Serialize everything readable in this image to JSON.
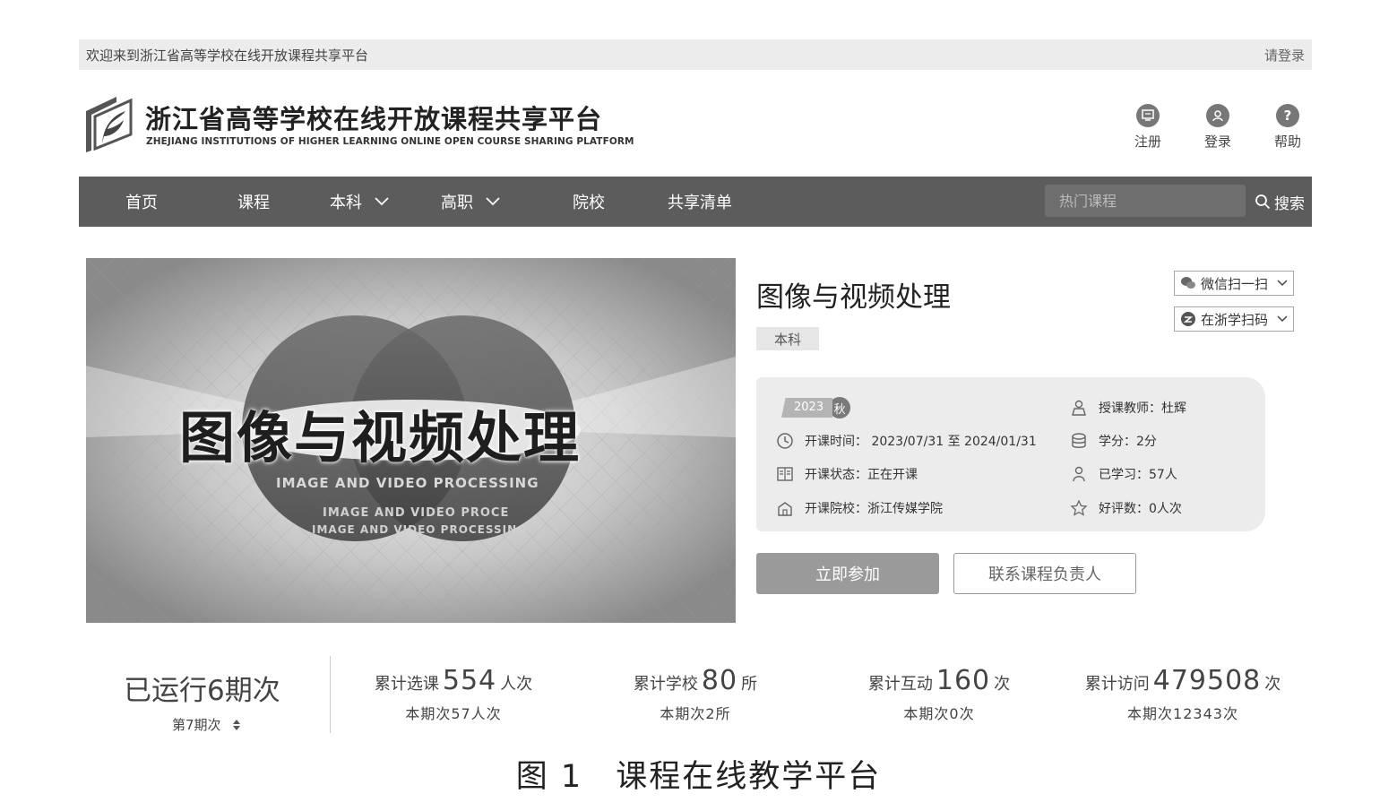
{
  "topbar": {
    "welcome": "欢迎来到浙江省高等学校在线开放课程共享平台",
    "login_link": "请登录"
  },
  "header": {
    "title": "浙江省高等学校在线开放课程共享平台",
    "subtitle": "ZHEJIANG INSTITUTIONS OF HIGHER LEARNING ONLINE OPEN COURSE SHARING PLATFORM",
    "actions": [
      {
        "label": "注册",
        "icon": "register-icon"
      },
      {
        "label": "登录",
        "icon": "user-icon"
      },
      {
        "label": "帮助",
        "icon": "help-icon"
      }
    ]
  },
  "nav": {
    "items": [
      {
        "label": "首页"
      },
      {
        "label": "课程"
      },
      {
        "label": "本科",
        "dropdown": true
      },
      {
        "label": "高职",
        "dropdown": true
      },
      {
        "label": "院校"
      },
      {
        "label": "共享清单"
      }
    ],
    "search_placeholder": "热门课程",
    "search_label": "搜索"
  },
  "banner": {
    "title": "图像与视频处理",
    "subtitle_lines": [
      "IMAGE AND VIDEO PROCESSING",
      "IMAGE AND VIDEO PROCE",
      "IMAGE AND VIDEO PROCESSING"
    ]
  },
  "course": {
    "title": "图像与视频处理",
    "level": "本科",
    "qr_wechat": "微信扫一扫",
    "qr_zjx": "在浙学扫码",
    "term_year": "2023",
    "term_season": "秋",
    "info": {
      "time": "开课时间： 2023/07/31 至 2024/01/31",
      "status": "开课状态：正在开课",
      "school": "开课院校：浙江传媒学院",
      "teacher": "授课教师：杜辉",
      "credit": "学分：2分",
      "learners": "已学习：57人",
      "reviews": "好评数：0人次"
    },
    "join_button": "立即参加",
    "contact_button": "联系课程负责人"
  },
  "stats": {
    "main": "已运行6期次",
    "period": "第7期次",
    "items": [
      {
        "label": "累计选课",
        "value": "554",
        "unit": "人次",
        "sub": "本期次57人次"
      },
      {
        "label": "累计学校",
        "value": "80",
        "unit": "所",
        "sub": "本期次2所"
      },
      {
        "label": "累计互动",
        "value": "160",
        "unit": "次",
        "sub": "本期次0次"
      },
      {
        "label": "累计访问",
        "value": "479508",
        "unit": "次",
        "sub": "本期次12343次"
      }
    ]
  },
  "caption": "图 1　课程在线教学平台"
}
